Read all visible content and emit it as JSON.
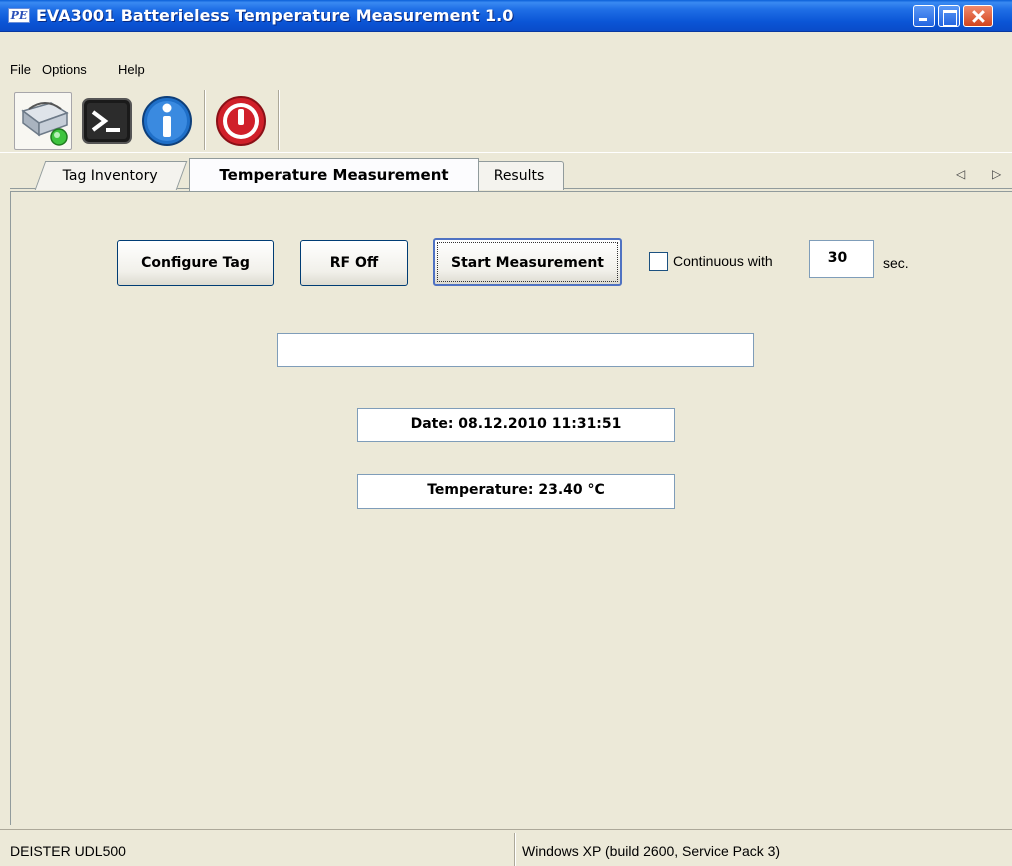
{
  "window": {
    "icon_text": "PE",
    "title": "EVA3001 Batterieless Temperature Measurement 1.0"
  },
  "menu": {
    "items": [
      "File",
      "Options",
      "Help"
    ]
  },
  "toolbar": {
    "buttons": [
      "reader-connect-icon",
      "console-icon",
      "info-icon",
      "power-off-icon"
    ]
  },
  "tabs": [
    {
      "label": "Tag Inventory",
      "selected": false
    },
    {
      "label": "Temperature Measurement",
      "selected": true
    },
    {
      "label": "Results",
      "selected": false
    }
  ],
  "controls": {
    "configure_label": "Configure Tag",
    "rf_label": "RF Off",
    "start_label": "Start Measurement",
    "continuous_label": "Continuous with",
    "continuous_checked": false,
    "interval_value": "30",
    "interval_unit": "sec."
  },
  "status_field": "",
  "readout": {
    "date": "Date:  08.12.2010 11:31:51",
    "temperature": "Temperature:  23.40 °C"
  },
  "statusbar": {
    "device": "DEISTER UDL500",
    "os": "Windows XP (build 2600, Service Pack 3)"
  },
  "colors": {
    "titlebar": "#0b55d6",
    "window_bg": "#ece9d8",
    "button_border": "#003c74",
    "power_red": "#d0202a",
    "info_blue": "#1f6fc8"
  }
}
